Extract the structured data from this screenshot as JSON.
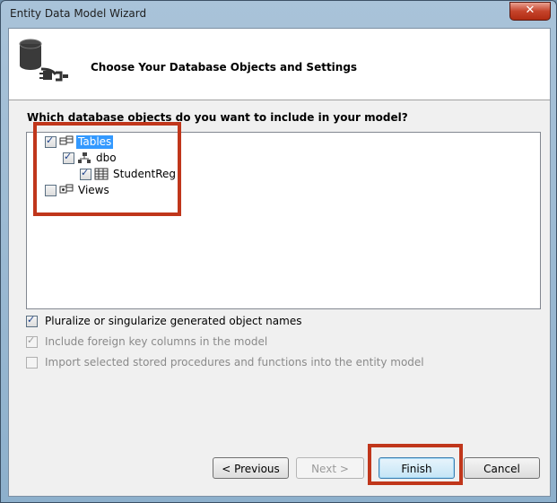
{
  "window": {
    "title": "Entity Data Model Wizard",
    "close_label": "✕"
  },
  "header": {
    "title": "Choose Your Database Objects and Settings"
  },
  "tree": {
    "question": "Which database objects do you want to include in your model?",
    "nodes": [
      {
        "label": "Tables",
        "checked": true,
        "selected": true
      },
      {
        "label": "dbo",
        "checked": true
      },
      {
        "label": "StudentReg",
        "checked": true
      },
      {
        "label": "Views",
        "checked": false
      }
    ]
  },
  "options": [
    {
      "label": "Pluralize or singularize generated object names",
      "checked": true,
      "enabled": true
    },
    {
      "label": "Include foreign key columns in the model",
      "checked": true,
      "enabled": false
    },
    {
      "label": "Import selected stored procedures and functions into the entity model",
      "checked": false,
      "enabled": false
    }
  ],
  "buttons": {
    "previous": "< Previous",
    "next": "Next >",
    "finish": "Finish",
    "cancel": "Cancel"
  },
  "colors": {
    "highlight": "#c0361b",
    "selection": "#3399ff"
  }
}
